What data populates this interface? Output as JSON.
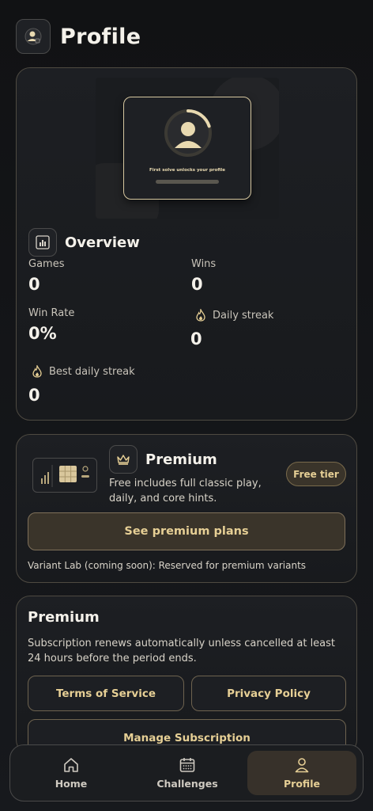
{
  "header": {
    "title": "Profile",
    "icon": "profile-avatar-icon"
  },
  "hero": {
    "caption": "First solve unlocks your profile",
    "progress": 0.2
  },
  "overview": {
    "title": "Overview",
    "stats": {
      "games": {
        "label": "Games",
        "value": "0"
      },
      "wins": {
        "label": "Wins",
        "value": "0"
      },
      "win_rate": {
        "label": "Win Rate",
        "value": "0%"
      },
      "daily_streak": {
        "label": "Daily streak",
        "value": "0"
      },
      "best_daily_streak": {
        "label": "Best daily streak",
        "value": "0"
      }
    }
  },
  "premium_card": {
    "title": "Premium",
    "description": "Free includes full classic play, daily, and core hints.",
    "badge": "Free tier",
    "button": "See premium plans",
    "variant_note": "Variant Lab (coming soon): Reserved for premium variants"
  },
  "subscription_card": {
    "title": "Premium",
    "description": "Subscription renews automatically unless cancelled at least 24 hours before the period ends.",
    "terms_button": "Terms of Service",
    "privacy_button": "Privacy Policy",
    "manage_button": "Manage Subscription"
  },
  "nav": {
    "home": "Home",
    "challenges": "Challenges",
    "profile": "Profile",
    "active": "profile"
  },
  "colors": {
    "accent": "#e6cf95",
    "background": "#131416",
    "card_border": "#4e4a41"
  }
}
